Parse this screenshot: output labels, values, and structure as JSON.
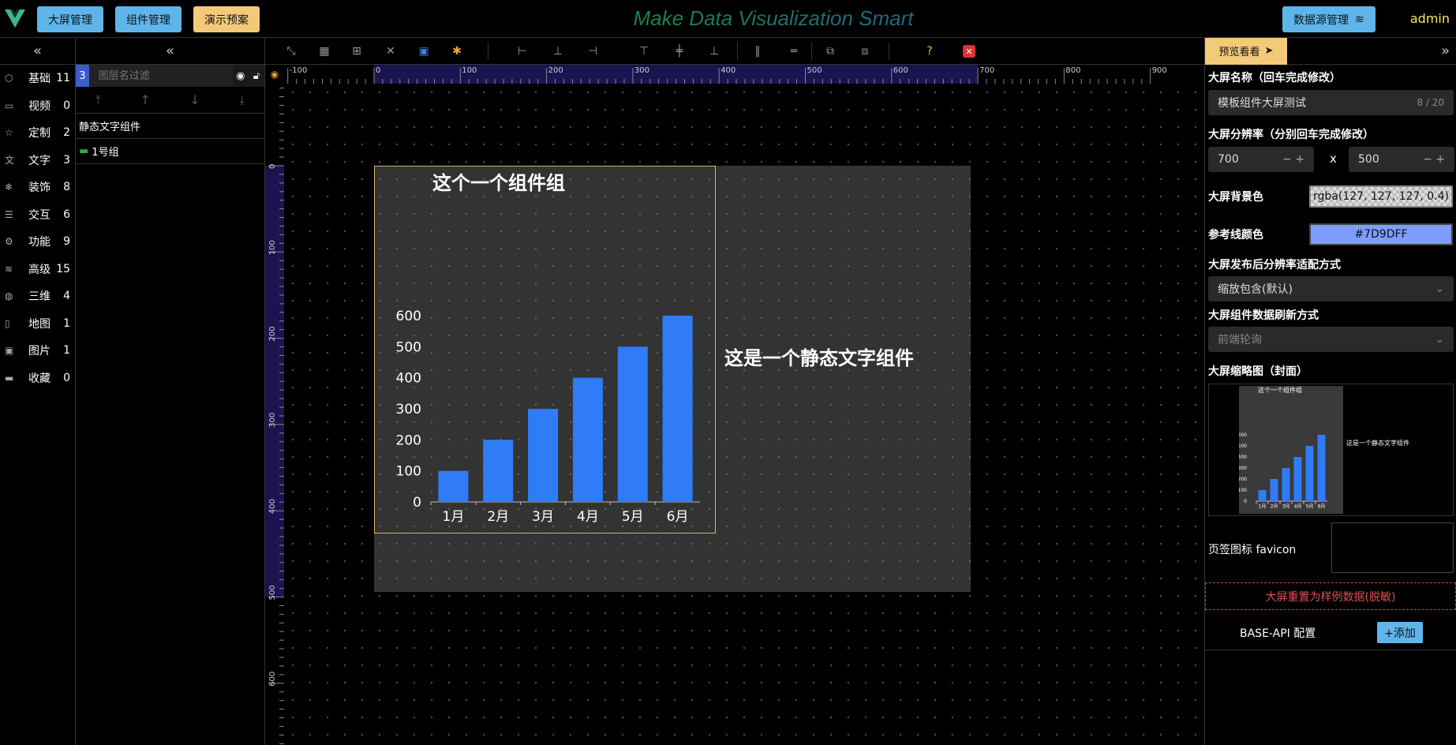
{
  "header": {
    "buttons": [
      {
        "label": "大屏管理",
        "color": "#5fb5ea"
      },
      {
        "label": "组件管理",
        "color": "#5fb5ea"
      },
      {
        "label": "演示预案",
        "color": "#f3c97a"
      }
    ],
    "brand": "Make Data Visualization Smart",
    "datasource_label": "数据源管理",
    "user": "admin"
  },
  "leftnav": {
    "collapse_icon": "double-chevron-left-icon",
    "items": [
      {
        "label": "基础",
        "count": "11",
        "icon": "cube-icon"
      },
      {
        "label": "视频",
        "count": "0",
        "icon": "video-icon"
      },
      {
        "label": "定制",
        "count": "2",
        "icon": "star-icon"
      },
      {
        "label": "文字",
        "count": "3",
        "icon": "translate-icon"
      },
      {
        "label": "装饰",
        "count": "8",
        "icon": "snowflake-icon"
      },
      {
        "label": "交互",
        "count": "6",
        "icon": "sliders-icon"
      },
      {
        "label": "功能",
        "count": "9",
        "icon": "gear-icon"
      },
      {
        "label": "高级",
        "count": "15",
        "icon": "layers-icon"
      },
      {
        "label": "三维",
        "count": "4",
        "icon": "globe-icon"
      },
      {
        "label": "地图",
        "count": "1",
        "icon": "map-icon"
      },
      {
        "label": "图片",
        "count": "1",
        "icon": "image-icon"
      },
      {
        "label": "收藏",
        "count": "0",
        "icon": "folder-icon"
      }
    ]
  },
  "layers": {
    "count": "3",
    "filter_placeholder": "图层名过滤",
    "items": [
      "静态文字组件",
      "1号组"
    ]
  },
  "ruler": {
    "x_labels": [
      "-100",
      "0",
      "100",
      "200",
      "300",
      "400",
      "500",
      "600",
      "700",
      "800",
      "900"
    ],
    "y_labels": [
      "0",
      "100",
      "200",
      "300",
      "400",
      "500",
      "600"
    ]
  },
  "canvas": {
    "group_title": "这个一个组件组",
    "static_text": "这是一个静态文字组件"
  },
  "chart_data": {
    "type": "bar",
    "categories": [
      "1月",
      "2月",
      "3月",
      "4月",
      "5月",
      "6月"
    ],
    "values": [
      100,
      200,
      300,
      400,
      500,
      600
    ],
    "ylim": [
      0,
      600
    ],
    "yticks": [
      "0",
      "100",
      "200",
      "300",
      "400",
      "500",
      "600"
    ],
    "bar_color": "#2f7cf6"
  },
  "rightpanel": {
    "preview_label": "预览看看",
    "name_label": "大屏名称（回车完成修改）",
    "name_value": "模板组件大屏测试",
    "name_count": "8 / 20",
    "resolution_label": "大屏分辨率（分别回车完成修改）",
    "width": "700",
    "height": "500",
    "x": "x",
    "bg_label": "大屏背景色",
    "bg_value": "rgba(127, 127, 127, 0.4)",
    "guide_label": "参考线颜色",
    "guide_value": "#7D9DFF",
    "guide_color": "#7D9DFF",
    "fit_label": "大屏发布后分辨率适配方式",
    "fit_value": "缩放包含(默认)",
    "refresh_label": "大屏组件数据刷新方式",
    "refresh_value": "前端轮询",
    "thumb_label": "大屏缩略图（封面）",
    "favicon_label": "页签图标 favicon",
    "reset_label": "大屏重置为样例数据(脱敏)",
    "api_label": "BASE-API 配置",
    "add_label": "+添加"
  },
  "thumbnail": {
    "group_title": "这个一个组件组",
    "static_text": "这是一个静态文字组件"
  }
}
